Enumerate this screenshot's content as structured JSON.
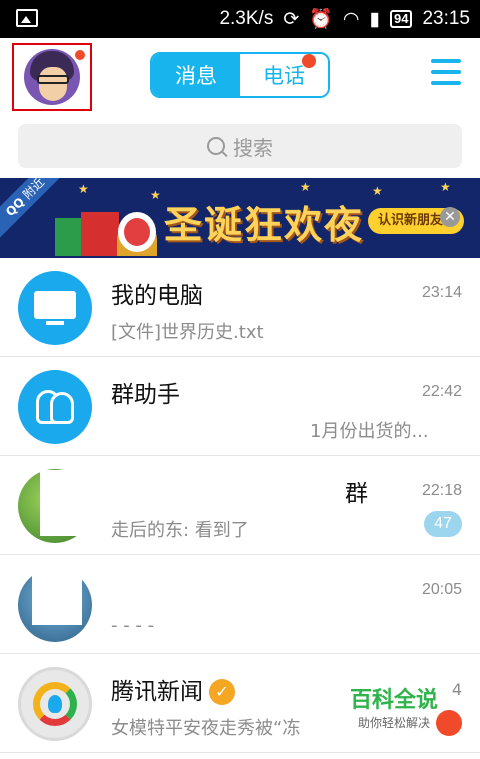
{
  "status_bar": {
    "speed": "2.3K/s",
    "battery": "94",
    "time": "23:15"
  },
  "header": {
    "tabs": [
      {
        "label": "消息",
        "active": true
      },
      {
        "label": "电话",
        "active": false
      }
    ]
  },
  "search": {
    "placeholder": "搜索"
  },
  "banner": {
    "tag": "附近",
    "tag_brand": "QQ",
    "title": "圣诞狂欢夜",
    "cta": "认识新朋友"
  },
  "chats": [
    {
      "name": "我的电脑",
      "time": "23:14",
      "preview": "[文件]世界历史.txt"
    },
    {
      "name": "群助手",
      "time": "22:42",
      "preview": "1月份出货的..."
    },
    {
      "name": "群",
      "time": "22:18",
      "preview": "走后的东: 看到了",
      "unread": "47"
    },
    {
      "name": "",
      "time": "20:05",
      "preview": "- - - -"
    },
    {
      "name": "腾讯新闻",
      "time": "4",
      "preview": "女模特平安夜走秀被“冻"
    }
  ],
  "watermark": {
    "main": "百科全说",
    "sub": "助你轻松解决"
  },
  "colors": {
    "accent": "#18b4ed",
    "badge_red": "#f04a2a",
    "banner_bg": "#13266a"
  }
}
